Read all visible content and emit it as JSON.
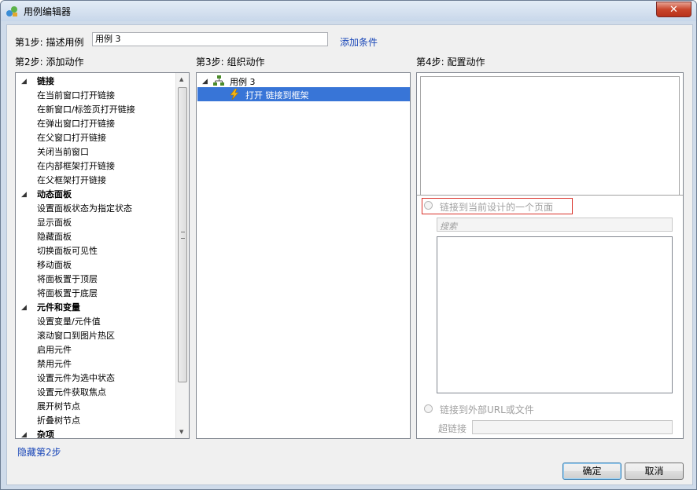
{
  "window": {
    "title": "用例编辑器",
    "close_glyph": "✕"
  },
  "step1": {
    "label": "第1步: 描述用例",
    "case_name": "用例 3",
    "add_condition": "添加条件"
  },
  "step2": {
    "label": "第2步: 添加动作",
    "groups": [
      {
        "title": "链接",
        "items": [
          "在当前窗口打开链接",
          "在新窗口/标签页打开链接",
          "在弹出窗口打开链接",
          "在父窗口打开链接",
          "关闭当前窗口",
          "在内部框架打开链接",
          "在父框架打开链接"
        ]
      },
      {
        "title": "动态面板",
        "items": [
          "设置面板状态为指定状态",
          "显示面板",
          "隐藏面板",
          "切换面板可见性",
          "移动面板",
          "将面板置于顶层",
          "将面板置于底层"
        ]
      },
      {
        "title": "元件和变量",
        "items": [
          "设置变量/元件值",
          "滚动窗口到图片热区",
          "启用元件",
          "禁用元件",
          "设置元件为选中状态",
          "设置元件获取焦点",
          "展开树节点",
          "折叠树节点"
        ]
      },
      {
        "title": "杂项",
        "items": []
      }
    ],
    "hide_link": "隐藏第2步"
  },
  "step3": {
    "label": "第3步: 组织动作",
    "case_node": "用例 3",
    "action_node": "打开 链接到框架"
  },
  "step4": {
    "label": "第4步: 配置动作",
    "radio_page": "链接到当前设计的一个页面",
    "search_placeholder": "搜索",
    "radio_url": "链接到外部URL或文件",
    "hyperlink_label": "超链接",
    "hyperlink_value": ""
  },
  "buttons": {
    "ok": "确定",
    "cancel": "取消"
  },
  "colors": {
    "selection": "#3875d7",
    "link": "#1a47b8",
    "highlight_box": "#d9312a"
  }
}
